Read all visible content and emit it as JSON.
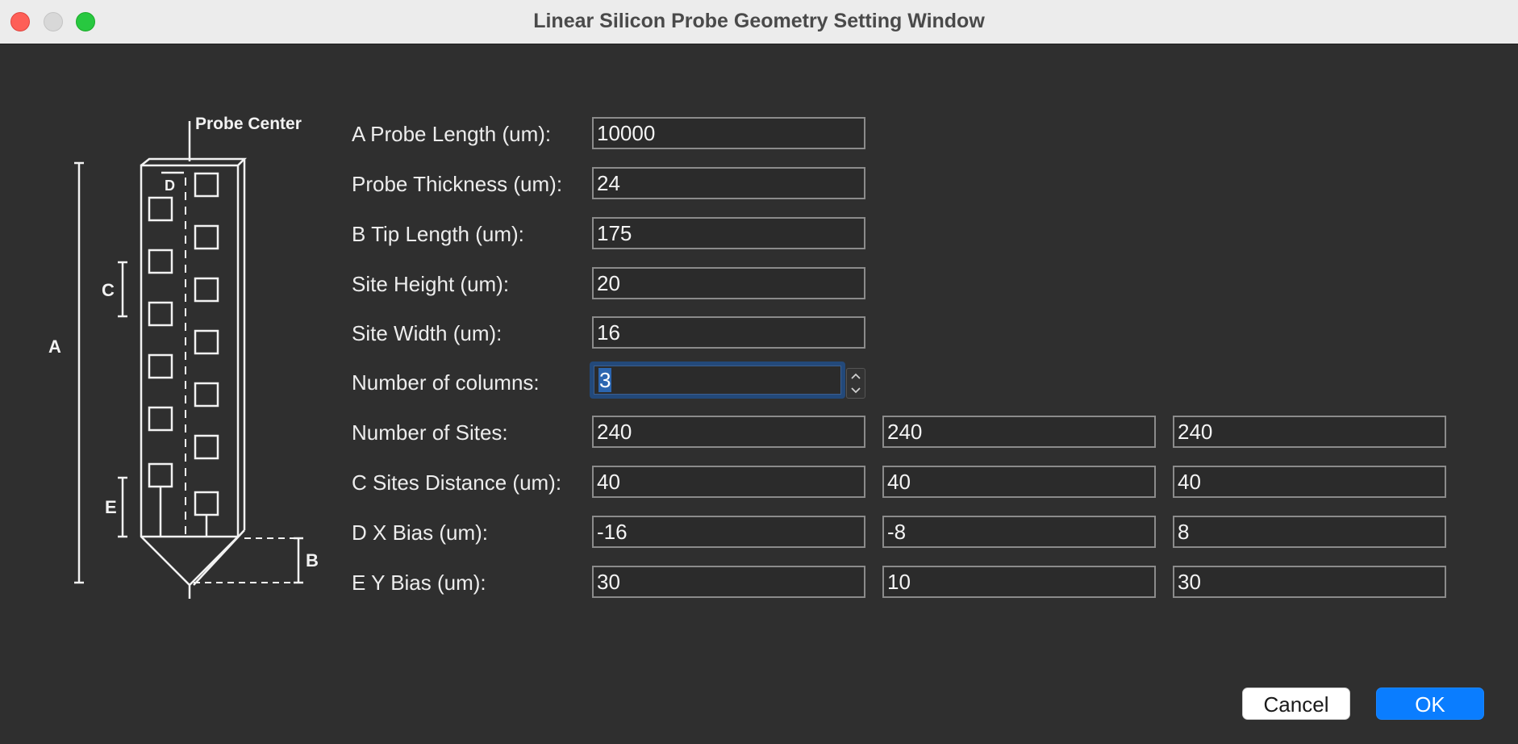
{
  "window": {
    "title": "Linear Silicon Probe Geometry Setting Window"
  },
  "diagram": {
    "probe_center": "Probe Center",
    "a": "A",
    "b": "B",
    "c": "C",
    "d": "D",
    "e": "E"
  },
  "form": {
    "probe_length": {
      "label": "A Probe Length (um):",
      "value": "10000"
    },
    "probe_thickness": {
      "label": "Probe Thickness (um):",
      "value": "24"
    },
    "tip_length": {
      "label": "B Tip Length (um):",
      "value": "175"
    },
    "site_height": {
      "label": "Site Height (um):",
      "value": "20"
    },
    "site_width": {
      "label": "Site Width (um):",
      "value": "16"
    },
    "num_columns": {
      "label": "Number of columns:",
      "value": "3"
    },
    "num_sites": {
      "label": "Number of Sites:",
      "values": [
        "240",
        "240",
        "240"
      ]
    },
    "c_sites_distance": {
      "label": "C Sites Distance (um):",
      "values": [
        "40",
        "40",
        "40"
      ]
    },
    "d_x_bias": {
      "label": "D X Bias (um):",
      "values": [
        "-16",
        "-8",
        "8"
      ]
    },
    "e_y_bias": {
      "label": "E Y Bias (um):",
      "values": [
        "30",
        "10",
        "30"
      ]
    }
  },
  "buttons": {
    "cancel": "Cancel",
    "ok": "OK"
  },
  "colors": {
    "accent": "#0a7dff",
    "focus_ring": "#23497a",
    "background": "#2f2f2f"
  }
}
